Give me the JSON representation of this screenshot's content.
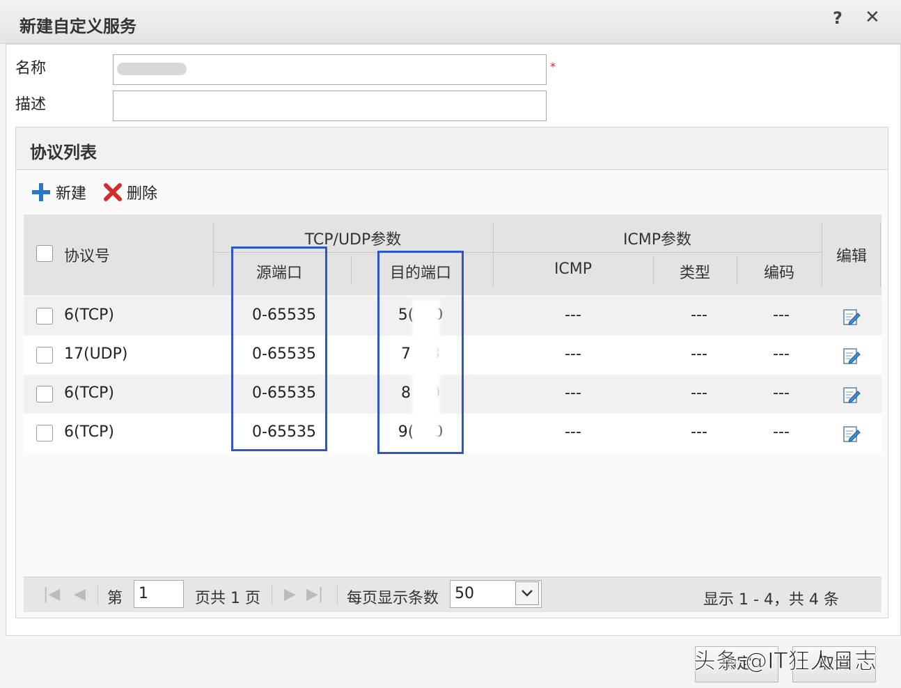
{
  "dialog": {
    "title": "新建自定义服务"
  },
  "form": {
    "name_label": "名称",
    "name_value": "",
    "required_mark": "*",
    "desc_label": "描述",
    "desc_value": ""
  },
  "panel": {
    "title": "协议列表",
    "new_label": "新建",
    "delete_label": "删除"
  },
  "table": {
    "headers": {
      "protocol": "协议号",
      "tcpudp_group": "TCP/UDP参数",
      "src_port": "源端口",
      "dst_port": "目的端口",
      "icmp_group": "ICMP参数",
      "icmp": "ICMP",
      "type": "类型",
      "code": "编码",
      "edit": "编辑"
    },
    "rows": [
      {
        "protocol": "6(TCP)",
        "src_port": "0-65535",
        "dst_port": "5(    0",
        "icmp": "---",
        "type": "---",
        "code": "---"
      },
      {
        "protocol": "17(UDP)",
        "src_port": "0-65535",
        "dst_port": "7    3",
        "icmp": "---",
        "type": "---",
        "code": "---"
      },
      {
        "protocol": "6(TCP)",
        "src_port": "0-65535",
        "dst_port": "8    0",
        "icmp": "---",
        "type": "---",
        "code": "---"
      },
      {
        "protocol": "6(TCP)",
        "src_port": "0-65535",
        "dst_port": "9(    0",
        "icmp": "---",
        "type": "---",
        "code": "---"
      }
    ]
  },
  "pager": {
    "page_prefix": "第",
    "page_value": "1",
    "page_suffix": "页共 1 页",
    "per_page_label": "每页显示条数",
    "per_page_value": "50",
    "summary": "显示 1 - 4，共 4 条"
  },
  "footer": {
    "ok_label": "确定",
    "cancel_label": "取消",
    "watermark": "头条 @IT狂人日志"
  },
  "colors": {
    "highlight_box": "#2f56c8",
    "add_icon": "#2a78c8",
    "delete_icon": "#d62b2b"
  }
}
